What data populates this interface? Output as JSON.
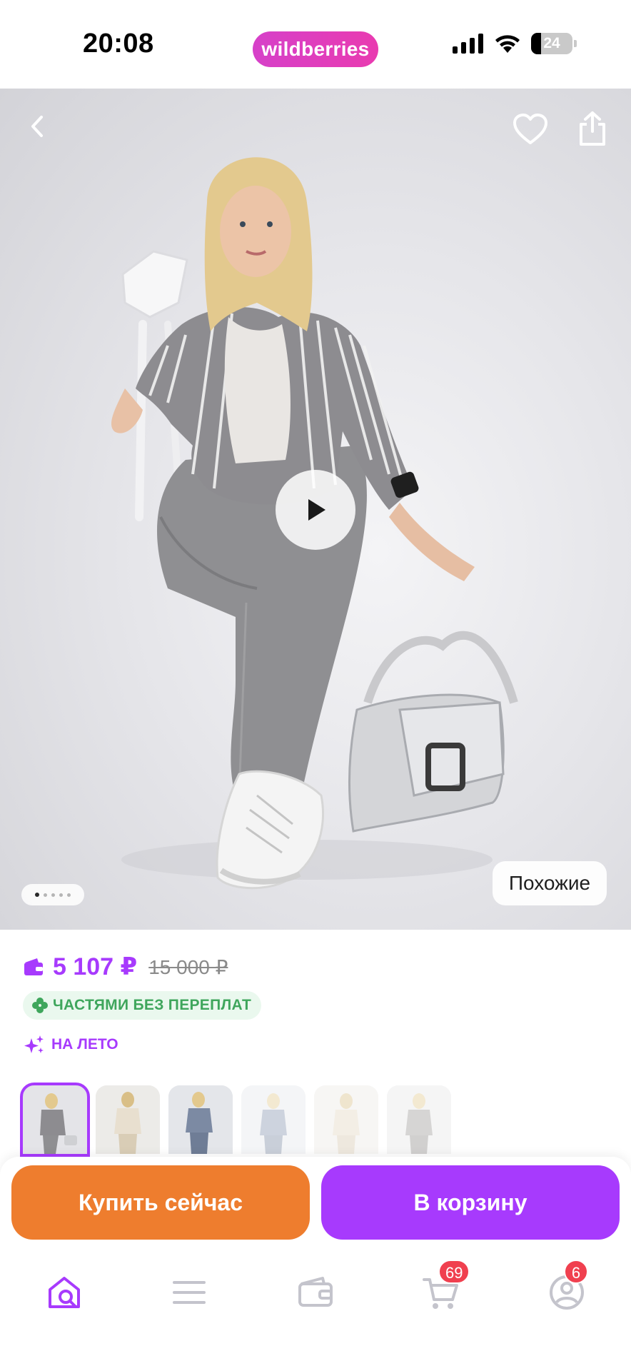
{
  "status_bar": {
    "time": "20:08",
    "brand": "wildberries",
    "battery": "24",
    "icons": [
      "signal-icon",
      "wifi-icon",
      "battery-icon"
    ]
  },
  "hero": {
    "similar_label": "Похожие",
    "gallery_dots": 5,
    "active_dot": 0
  },
  "product": {
    "price": "5 107 ₽",
    "old_price": "15 000 ₽",
    "installments_label": "ЧАСТЯМИ БЕЗ ПЕРЕПЛАТ",
    "promo_label": "НА ЛЕТО"
  },
  "thumbnails": {
    "count": 6,
    "selected": 0
  },
  "actions": {
    "buy_now": "Купить сейчас",
    "add_to_cart": "В корзину"
  },
  "tabbar": {
    "cart_badge": "69",
    "profile_badge": "6"
  },
  "colors": {
    "accent": "#a73afd",
    "brand_pill": "#d640c9",
    "buy_now": "#ee7d2e",
    "installments_text": "#3fa65c",
    "badge": "#f0404f"
  }
}
